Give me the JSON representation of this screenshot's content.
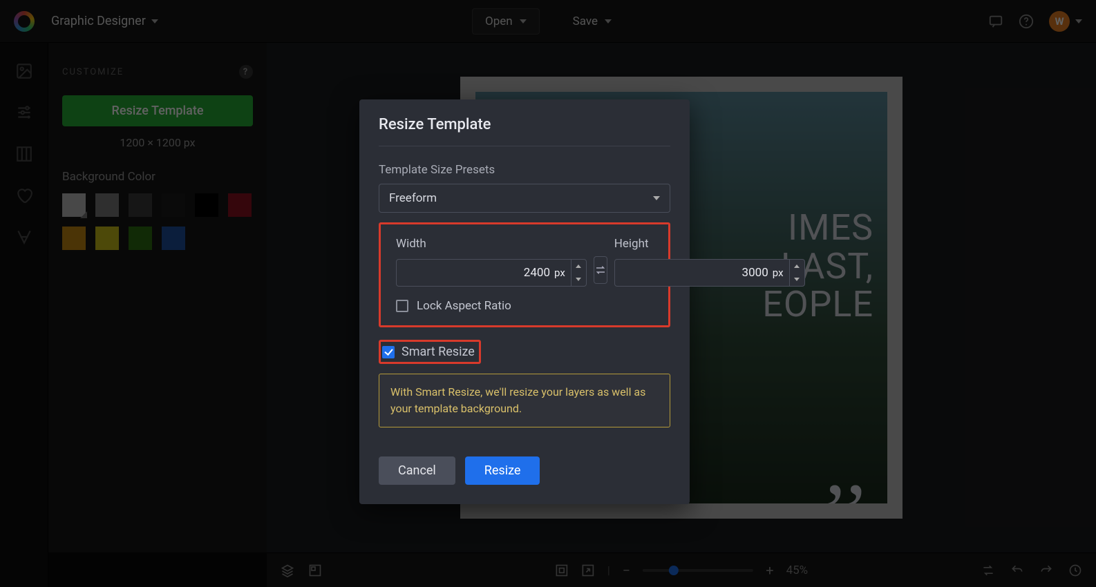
{
  "header": {
    "mode_label": "Graphic Designer",
    "open_label": "Open",
    "save_label": "Save",
    "avatar_initial": "W"
  },
  "sidebar": {
    "heading": "CUSTOMIZE",
    "resize_button": "Resize Template",
    "dimensions": "1200 × 1200 px",
    "bg_label": "Background Color",
    "swatches": [
      {
        "color": "#bdbdbd",
        "selected": true
      },
      {
        "color": "#7d7d7d"
      },
      {
        "color": "#3a3a3a"
      },
      {
        "color": "#1b1b1b"
      },
      {
        "color": "#000000"
      },
      {
        "color": "#8b1220"
      },
      {
        "color": "#c48a12"
      },
      {
        "color": "#cbbf19"
      },
      {
        "color": "#2f6e12"
      },
      {
        "color": "#1f4f9e"
      }
    ]
  },
  "canvas": {
    "quote_line1": "IMES",
    "quote_line2": "LAST,",
    "quote_line3": "EOPLE"
  },
  "footer": {
    "zoom_label": "45%"
  },
  "dialog": {
    "title": "Resize Template",
    "presets_label": "Template Size Presets",
    "preset_value": "Freeform",
    "width_label": "Width",
    "width_value": "2400",
    "height_label": "Height",
    "height_value": "3000",
    "unit": "px",
    "lock_label": "Lock Aspect Ratio",
    "lock_checked": false,
    "smart_label": "Smart Resize",
    "smart_checked": true,
    "info_text": "With Smart Resize, we'll resize your layers as well as your template background.",
    "cancel_label": "Cancel",
    "confirm_label": "Resize"
  },
  "colors": {
    "accent_blue": "#1f6feb",
    "accent_green": "#27ae35",
    "highlight_red": "#d83a2b"
  }
}
